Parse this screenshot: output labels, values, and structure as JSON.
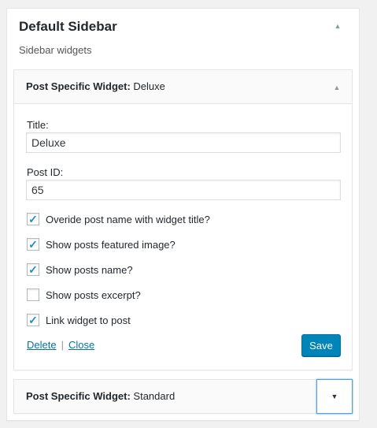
{
  "sidebar": {
    "title": "Default Sidebar",
    "description": "Sidebar widgets",
    "toggle_icon": "triangle-up"
  },
  "widget_deluxe": {
    "title": "Post Specific Widget:",
    "instance": "Deluxe",
    "toggle_icon": "triangle-up",
    "fields": {
      "title_label": "Title:",
      "title_value": "Deluxe",
      "post_id_label": "Post ID:",
      "post_id_value": "65"
    },
    "options": [
      {
        "label": "Overide post name with widget title?",
        "checked": true
      },
      {
        "label": "Show posts featured image?",
        "checked": true
      },
      {
        "label": "Show posts name?",
        "checked": true
      },
      {
        "label": "Show posts excerpt?",
        "checked": false
      },
      {
        "label": "Link widget to post",
        "checked": true
      }
    ],
    "actions": {
      "delete_label": "Delete",
      "separator": "|",
      "close_label": "Close",
      "save_label": "Save"
    }
  },
  "widget_standard": {
    "title": "Post Specific Widget:",
    "instance": "Standard",
    "toggle_icon": "triangle-down"
  },
  "colors": {
    "accent": "#0085ba",
    "link": "#0073aa",
    "check": "#1e8cbe",
    "background": "#f1f1f1"
  }
}
